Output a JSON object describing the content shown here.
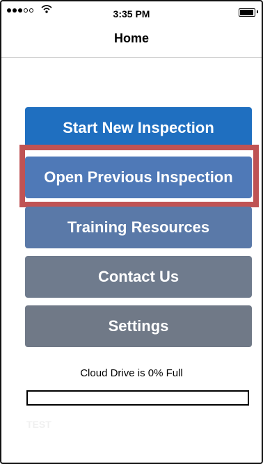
{
  "status_bar": {
    "time": "3:35 PM",
    "signal_icon": "signal-dots-icon",
    "wifi_icon": "wifi-icon",
    "battery_icon": "battery-icon"
  },
  "nav": {
    "title": "Home"
  },
  "menu": {
    "buttons": [
      {
        "label": "Start New Inspection",
        "color": "#1f6fc0"
      },
      {
        "label": "Open Previous Inspection",
        "color": "#4f79b7"
      },
      {
        "label": "Training Resources",
        "color": "#5a79a8"
      },
      {
        "label": "Contact Us",
        "color": "#6f7b8d"
      },
      {
        "label": "Settings",
        "color": "#707987"
      }
    ]
  },
  "highlight": {
    "color": "#bf5354"
  },
  "cloud": {
    "label": "Cloud Drive is 0% Full",
    "percent_full": 0
  },
  "footer": {
    "test_label": "TEST"
  }
}
